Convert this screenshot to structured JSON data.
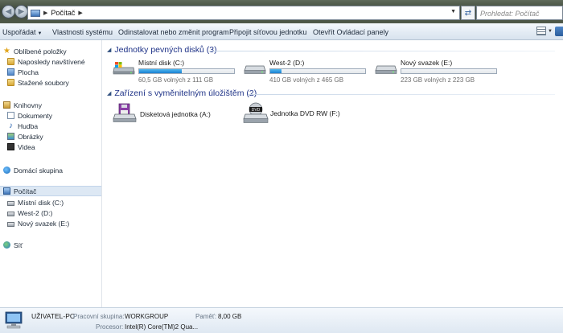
{
  "address_bar": {
    "breadcrumb": [
      "Počítač"
    ],
    "search_placeholder": "Prohledat: Počítač"
  },
  "toolbar": {
    "organize": "Uspořádat",
    "system_properties": "Vlastnosti systému",
    "uninstall": "Odinstalovat nebo změnit program",
    "map_drive": "Připojit síťovou jednotku",
    "control_panel": "Otevřít Ovládací panely"
  },
  "sidebar": {
    "favorites": {
      "label": "Oblíbené položky",
      "items": [
        "Naposledy navštívené",
        "Plocha",
        "Stažené soubory"
      ]
    },
    "libraries": {
      "label": "Knihovny",
      "items": [
        "Dokumenty",
        "Hudba",
        "Obrázky",
        "Videa"
      ]
    },
    "homegroup": {
      "label": "Domácí skupina"
    },
    "computer": {
      "label": "Počítač",
      "items": [
        "Místní disk (C:)",
        "West-2 (D:)",
        "Nový svazek (E:)"
      ]
    },
    "network": {
      "label": "Síť"
    }
  },
  "main": {
    "hdd_group": "Jednotky pevných disků (3)",
    "removable_group": "Zařízení s vyměnitelným úložištěm (2)",
    "drives": [
      {
        "name": "Místní disk (C:)",
        "free_text": "60,5 GB volných z 111 GB",
        "used_fraction": 0.45
      },
      {
        "name": "West-2 (D:)",
        "free_text": "410 GB volných z 465 GB",
        "used_fraction": 0.12
      },
      {
        "name": "Nový svazek (E:)",
        "free_text": "223 GB volných z 223 GB",
        "used_fraction": 0.0
      }
    ],
    "removable": [
      {
        "name": "Disketová jednotka (A:)",
        "icon": "floppy-drive-icon"
      },
      {
        "name": "Jednotka DVD RW (F:)",
        "icon": "dvd-drive-icon"
      }
    ]
  },
  "details": {
    "computer_name": "UŽIVATEL-PC",
    "workgroup_label": "Pracovní skupina:",
    "workgroup_value": "WORKGROUP",
    "memory_label": "Paměť:",
    "memory_value": "8,00 GB",
    "processor_label": "Procesor:",
    "processor_value": "Intel(R) Core(TM)2 Qua..."
  },
  "colors": {
    "accent": "#1e3287",
    "bar_fill": "#1a7fd0",
    "selection": "#dde8f4"
  }
}
